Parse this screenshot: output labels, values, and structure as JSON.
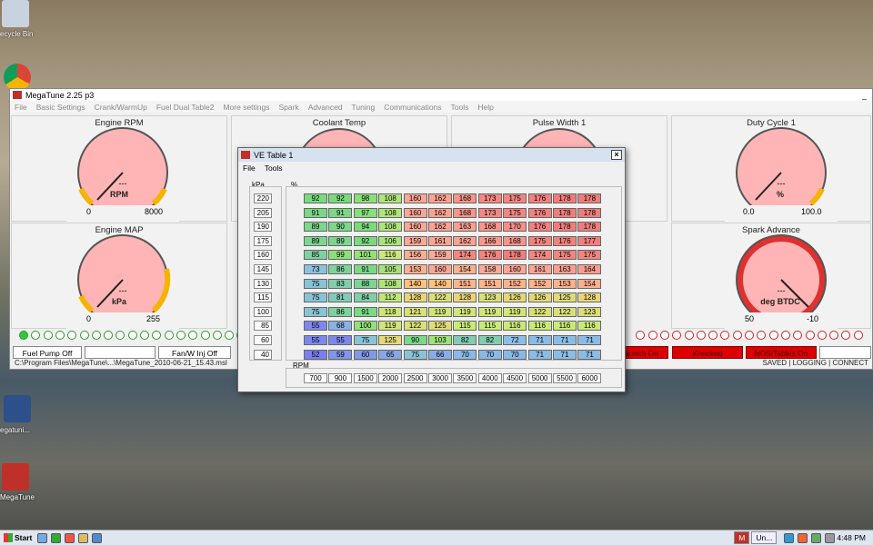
{
  "desktop": {
    "icons": [
      {
        "name": "recycle-bin",
        "label": "ecycle Bin"
      },
      {
        "name": "chrome",
        "label": ""
      },
      {
        "name": "megatune-shortcut-1",
        "label": "egatuni..."
      },
      {
        "name": "megatune-shortcut-2",
        "label": "MegaTune"
      }
    ]
  },
  "main_window": {
    "title": "MegaTune 2.25 p3",
    "menu": [
      "File",
      "Basic Settings",
      "Crank/WarmUp",
      "Fuel Dual Table2",
      "More settings",
      "Spark",
      "Advanced",
      "Tuning",
      "Communications",
      "Tools",
      "Help"
    ],
    "gauges": [
      {
        "title": "Engine RPM",
        "value": "---",
        "unit": "RPM",
        "min": "0",
        "max": "8000"
      },
      {
        "title": "Coolant Temp"
      },
      {
        "title": "Pulse Width 1"
      },
      {
        "title": "Duty Cycle 1",
        "value": "---",
        "unit": "%",
        "min": "0.0",
        "max": "100.0"
      },
      {
        "title": "Engine MAP",
        "value": "---",
        "unit": "kPa",
        "min": "0",
        "max": "255"
      },
      {
        "title": "Spark Advance",
        "value": "---",
        "unit": "deg BTDC",
        "min": "50",
        "max": "-10"
      }
    ],
    "status_buttons_left": [
      "Fuel Pump Off",
      "",
      "Fan/W Inj Off"
    ],
    "status_buttons_right": [
      "Launch On",
      "Knocked",
      "NOS/Tables On",
      ""
    ],
    "path": "C:\\Program Files\\MegaTune\\...\\MegaTune_2010-06-21_15.43.msl",
    "status_right": "SAVED  | LOGGING  | CONNECT"
  },
  "ve_table": {
    "title": "VE Table 1",
    "menu": [
      "File",
      "Tools"
    ],
    "kpa_label": "kPa",
    "pct_label": "%",
    "rpm_label": "RPM",
    "kpa": [
      "220",
      "205",
      "190",
      "175",
      "160",
      "145",
      "130",
      "115",
      "100",
      "85",
      "60",
      "40"
    ],
    "rpm": [
      "700",
      "900",
      "1500",
      "2000",
      "2500",
      "3000",
      "3500",
      "4000",
      "4500",
      "5000",
      "5500",
      "6000"
    ],
    "rows": [
      [
        "92",
        "92",
        "98",
        "108",
        "160",
        "162",
        "168",
        "173",
        "175",
        "176",
        "178",
        "178"
      ],
      [
        "91",
        "91",
        "97",
        "108",
        "160",
        "162",
        "168",
        "173",
        "175",
        "176",
        "178",
        "178"
      ],
      [
        "89",
        "90",
        "94",
        "108",
        "160",
        "162",
        "163",
        "168",
        "170",
        "176",
        "178",
        "178"
      ],
      [
        "89",
        "89",
        "92",
        "106",
        "159",
        "161",
        "162",
        "166",
        "168",
        "175",
        "176",
        "177"
      ],
      [
        "85",
        "99",
        "101",
        "116",
        "156",
        "159",
        "174",
        "176",
        "178",
        "174",
        "175",
        "175"
      ],
      [
        "73",
        "86",
        "91",
        "105",
        "153",
        "160",
        "154",
        "158",
        "160",
        "161",
        "163",
        "164"
      ],
      [
        "75",
        "83",
        "88",
        "108",
        "140",
        "140",
        "151",
        "151",
        "152",
        "152",
        "153",
        "154"
      ],
      [
        "75",
        "81",
        "84",
        "112",
        "128",
        "122",
        "128",
        "123",
        "126",
        "126",
        "125",
        "128"
      ],
      [
        "75",
        "86",
        "91",
        "118",
        "121",
        "119",
        "119",
        "119",
        "119",
        "122",
        "122",
        "123"
      ],
      [
        "55",
        "68",
        "100",
        "119",
        "122",
        "125",
        "115",
        "115",
        "116",
        "116",
        "116",
        "116"
      ],
      [
        "55",
        "55",
        "75",
        "125",
        "90",
        "103",
        "82",
        "82",
        "72",
        "71",
        "71",
        "71"
      ],
      [
        "52",
        "59",
        "60",
        "65",
        "75",
        "66",
        "70",
        "70",
        "70",
        "71",
        "71",
        "71"
      ]
    ]
  },
  "taskbar": {
    "start": "Start",
    "items": [
      "M",
      "Un..."
    ],
    "clock": "4:48 PM"
  }
}
